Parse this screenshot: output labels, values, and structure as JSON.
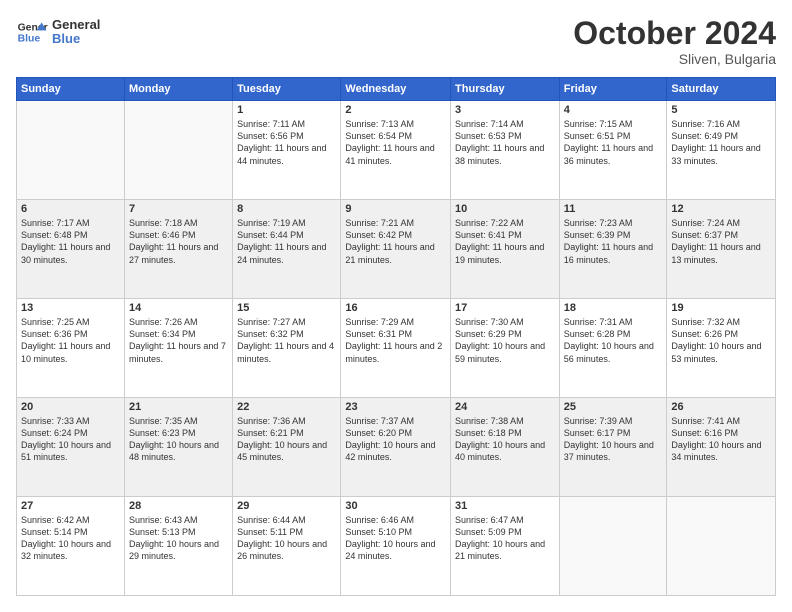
{
  "header": {
    "logo_line1": "General",
    "logo_line2": "Blue",
    "month_title": "October 2024",
    "location": "Sliven, Bulgaria"
  },
  "days_of_week": [
    "Sunday",
    "Monday",
    "Tuesday",
    "Wednesday",
    "Thursday",
    "Friday",
    "Saturday"
  ],
  "weeks": [
    [
      {
        "day": "",
        "sunrise": "",
        "sunset": "",
        "daylight": ""
      },
      {
        "day": "",
        "sunrise": "",
        "sunset": "",
        "daylight": ""
      },
      {
        "day": "1",
        "sunrise": "Sunrise: 7:11 AM",
        "sunset": "Sunset: 6:56 PM",
        "daylight": "Daylight: 11 hours and 44 minutes."
      },
      {
        "day": "2",
        "sunrise": "Sunrise: 7:13 AM",
        "sunset": "Sunset: 6:54 PM",
        "daylight": "Daylight: 11 hours and 41 minutes."
      },
      {
        "day": "3",
        "sunrise": "Sunrise: 7:14 AM",
        "sunset": "Sunset: 6:53 PM",
        "daylight": "Daylight: 11 hours and 38 minutes."
      },
      {
        "day": "4",
        "sunrise": "Sunrise: 7:15 AM",
        "sunset": "Sunset: 6:51 PM",
        "daylight": "Daylight: 11 hours and 36 minutes."
      },
      {
        "day": "5",
        "sunrise": "Sunrise: 7:16 AM",
        "sunset": "Sunset: 6:49 PM",
        "daylight": "Daylight: 11 hours and 33 minutes."
      }
    ],
    [
      {
        "day": "6",
        "sunrise": "Sunrise: 7:17 AM",
        "sunset": "Sunset: 6:48 PM",
        "daylight": "Daylight: 11 hours and 30 minutes."
      },
      {
        "day": "7",
        "sunrise": "Sunrise: 7:18 AM",
        "sunset": "Sunset: 6:46 PM",
        "daylight": "Daylight: 11 hours and 27 minutes."
      },
      {
        "day": "8",
        "sunrise": "Sunrise: 7:19 AM",
        "sunset": "Sunset: 6:44 PM",
        "daylight": "Daylight: 11 hours and 24 minutes."
      },
      {
        "day": "9",
        "sunrise": "Sunrise: 7:21 AM",
        "sunset": "Sunset: 6:42 PM",
        "daylight": "Daylight: 11 hours and 21 minutes."
      },
      {
        "day": "10",
        "sunrise": "Sunrise: 7:22 AM",
        "sunset": "Sunset: 6:41 PM",
        "daylight": "Daylight: 11 hours and 19 minutes."
      },
      {
        "day": "11",
        "sunrise": "Sunrise: 7:23 AM",
        "sunset": "Sunset: 6:39 PM",
        "daylight": "Daylight: 11 hours and 16 minutes."
      },
      {
        "day": "12",
        "sunrise": "Sunrise: 7:24 AM",
        "sunset": "Sunset: 6:37 PM",
        "daylight": "Daylight: 11 hours and 13 minutes."
      }
    ],
    [
      {
        "day": "13",
        "sunrise": "Sunrise: 7:25 AM",
        "sunset": "Sunset: 6:36 PM",
        "daylight": "Daylight: 11 hours and 10 minutes."
      },
      {
        "day": "14",
        "sunrise": "Sunrise: 7:26 AM",
        "sunset": "Sunset: 6:34 PM",
        "daylight": "Daylight: 11 hours and 7 minutes."
      },
      {
        "day": "15",
        "sunrise": "Sunrise: 7:27 AM",
        "sunset": "Sunset: 6:32 PM",
        "daylight": "Daylight: 11 hours and 4 minutes."
      },
      {
        "day": "16",
        "sunrise": "Sunrise: 7:29 AM",
        "sunset": "Sunset: 6:31 PM",
        "daylight": "Daylight: 11 hours and 2 minutes."
      },
      {
        "day": "17",
        "sunrise": "Sunrise: 7:30 AM",
        "sunset": "Sunset: 6:29 PM",
        "daylight": "Daylight: 10 hours and 59 minutes."
      },
      {
        "day": "18",
        "sunrise": "Sunrise: 7:31 AM",
        "sunset": "Sunset: 6:28 PM",
        "daylight": "Daylight: 10 hours and 56 minutes."
      },
      {
        "day": "19",
        "sunrise": "Sunrise: 7:32 AM",
        "sunset": "Sunset: 6:26 PM",
        "daylight": "Daylight: 10 hours and 53 minutes."
      }
    ],
    [
      {
        "day": "20",
        "sunrise": "Sunrise: 7:33 AM",
        "sunset": "Sunset: 6:24 PM",
        "daylight": "Daylight: 10 hours and 51 minutes."
      },
      {
        "day": "21",
        "sunrise": "Sunrise: 7:35 AM",
        "sunset": "Sunset: 6:23 PM",
        "daylight": "Daylight: 10 hours and 48 minutes."
      },
      {
        "day": "22",
        "sunrise": "Sunrise: 7:36 AM",
        "sunset": "Sunset: 6:21 PM",
        "daylight": "Daylight: 10 hours and 45 minutes."
      },
      {
        "day": "23",
        "sunrise": "Sunrise: 7:37 AM",
        "sunset": "Sunset: 6:20 PM",
        "daylight": "Daylight: 10 hours and 42 minutes."
      },
      {
        "day": "24",
        "sunrise": "Sunrise: 7:38 AM",
        "sunset": "Sunset: 6:18 PM",
        "daylight": "Daylight: 10 hours and 40 minutes."
      },
      {
        "day": "25",
        "sunrise": "Sunrise: 7:39 AM",
        "sunset": "Sunset: 6:17 PM",
        "daylight": "Daylight: 10 hours and 37 minutes."
      },
      {
        "day": "26",
        "sunrise": "Sunrise: 7:41 AM",
        "sunset": "Sunset: 6:16 PM",
        "daylight": "Daylight: 10 hours and 34 minutes."
      }
    ],
    [
      {
        "day": "27",
        "sunrise": "Sunrise: 6:42 AM",
        "sunset": "Sunset: 5:14 PM",
        "daylight": "Daylight: 10 hours and 32 minutes."
      },
      {
        "day": "28",
        "sunrise": "Sunrise: 6:43 AM",
        "sunset": "Sunset: 5:13 PM",
        "daylight": "Daylight: 10 hours and 29 minutes."
      },
      {
        "day": "29",
        "sunrise": "Sunrise: 6:44 AM",
        "sunset": "Sunset: 5:11 PM",
        "daylight": "Daylight: 10 hours and 26 minutes."
      },
      {
        "day": "30",
        "sunrise": "Sunrise: 6:46 AM",
        "sunset": "Sunset: 5:10 PM",
        "daylight": "Daylight: 10 hours and 24 minutes."
      },
      {
        "day": "31",
        "sunrise": "Sunrise: 6:47 AM",
        "sunset": "Sunset: 5:09 PM",
        "daylight": "Daylight: 10 hours and 21 minutes."
      },
      {
        "day": "",
        "sunrise": "",
        "sunset": "",
        "daylight": ""
      },
      {
        "day": "",
        "sunrise": "",
        "sunset": "",
        "daylight": ""
      }
    ]
  ]
}
